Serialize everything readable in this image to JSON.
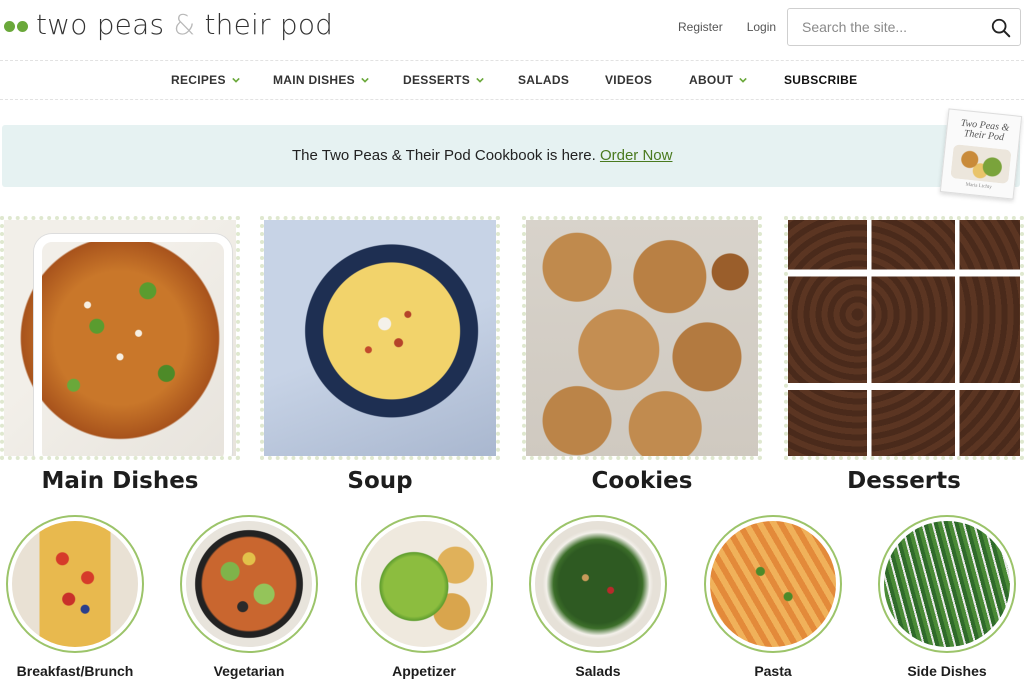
{
  "colors": {
    "brand_green": "#6aa83a",
    "link_green": "#4a7a1f",
    "banner_bg": "#e6f2f2",
    "ring_green": "#9cc46a"
  },
  "header": {
    "logo": {
      "part1": "two peas ",
      "amp": "&",
      "part2": " their pod",
      "icon": "pea-dots-icon"
    },
    "register": "Register",
    "login": "Login",
    "search": {
      "placeholder": "Search the site...",
      "icon": "search-icon"
    }
  },
  "nav": {
    "items": [
      {
        "label": "RECIPES",
        "dropdown": true
      },
      {
        "label": "MAIN DISHES",
        "dropdown": true
      },
      {
        "label": "DESSERTS",
        "dropdown": true
      },
      {
        "label": "SALADS",
        "dropdown": false
      },
      {
        "label": "VIDEOS",
        "dropdown": false
      },
      {
        "label": "ABOUT",
        "dropdown": true
      },
      {
        "label": "SUBSCRIBE",
        "dropdown": false
      }
    ]
  },
  "banner": {
    "text": "The Two Peas & Their Pod Cookbook is here. ",
    "link": "Order Now",
    "book": {
      "title": "Two Peas & Their Pod",
      "author": "Maria Lichty"
    }
  },
  "categories": [
    {
      "label": "Main Dishes",
      "image": "enchiladas-photo"
    },
    {
      "label": "Soup",
      "image": "potato-soup-photo"
    },
    {
      "label": "Cookies",
      "image": "pretzel-cookies-photo"
    },
    {
      "label": "Desserts",
      "image": "brownies-photo"
    }
  ],
  "subcategories": [
    {
      "label": "Breakfast/Brunch",
      "image": "breakfast-photo"
    },
    {
      "label": "Vegetarian",
      "image": "vegetarian-photo"
    },
    {
      "label": "Appetizer",
      "image": "guacamole-photo"
    },
    {
      "label": "Salads",
      "image": "kale-salad-photo"
    },
    {
      "label": "Pasta",
      "image": "baked-pasta-photo"
    },
    {
      "label": "Side Dishes",
      "image": "green-beans-photo"
    }
  ]
}
